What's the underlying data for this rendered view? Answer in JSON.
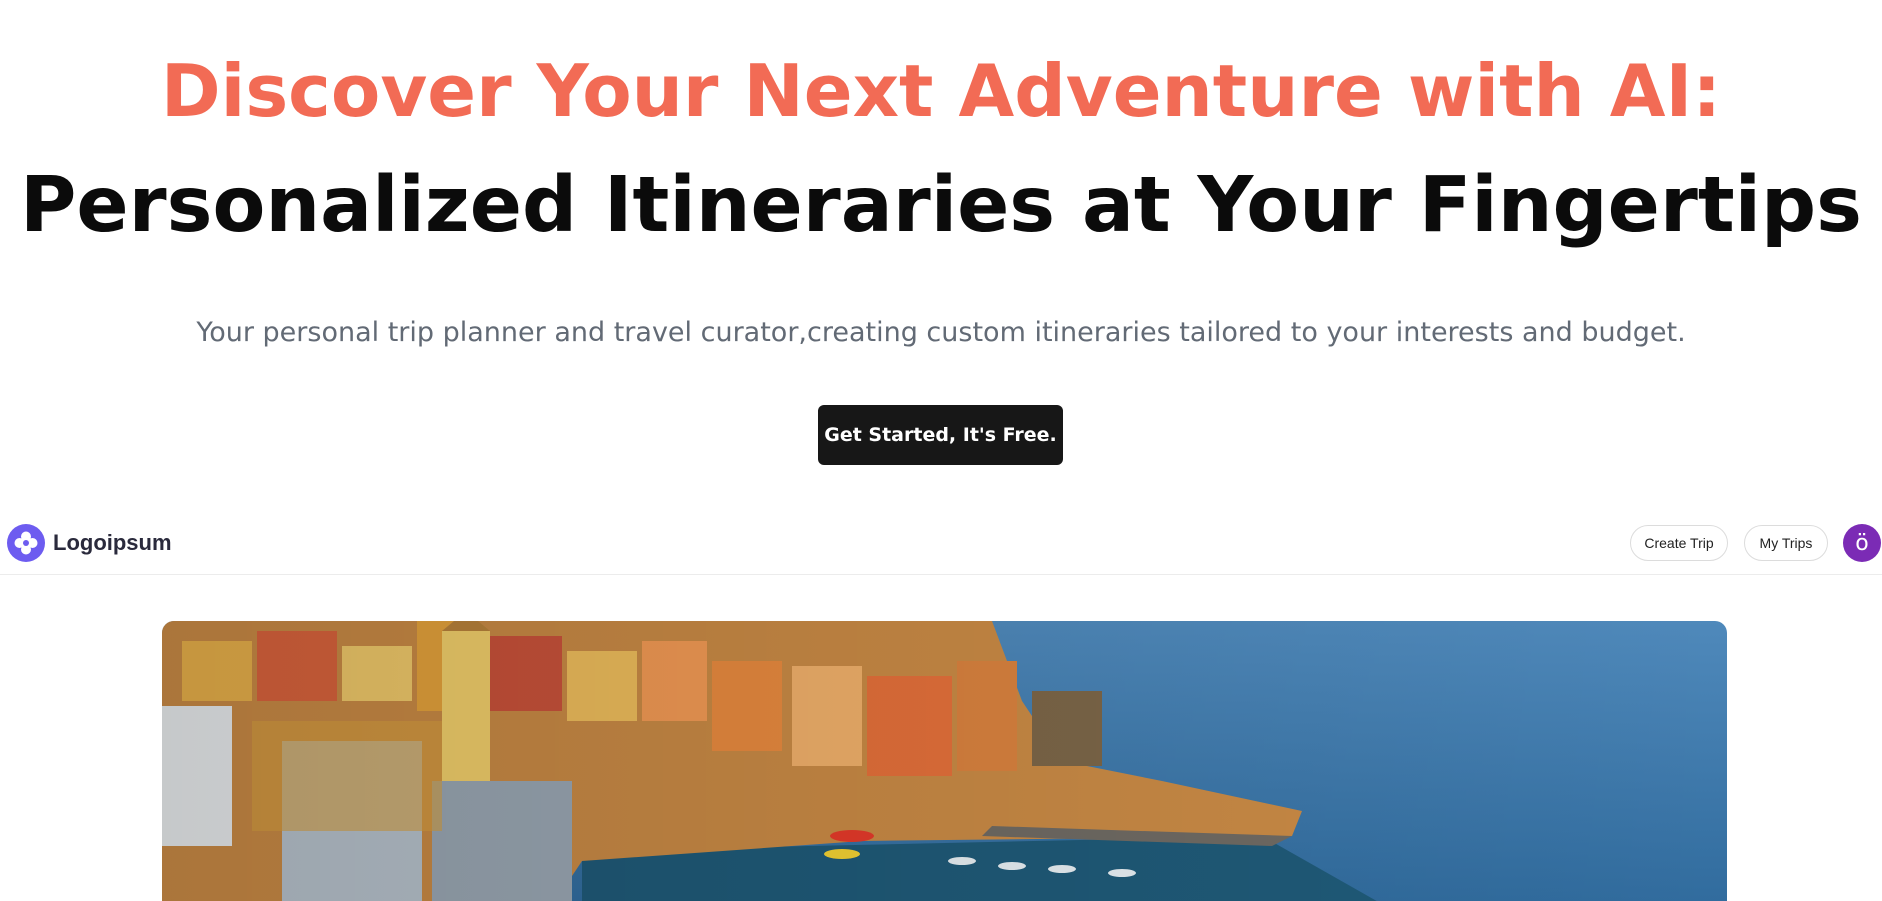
{
  "hero": {
    "headline_accent": "Discover Your Next Adventure with AI:",
    "headline_main": "Personalized Itineraries at Your Fingertips",
    "subtitle": "Your personal trip planner and travel curator,creating custom itineraries tailored to your interests and budget.",
    "cta_label": "Get Started, It's Free."
  },
  "preview": {
    "logo_text": "Logoipsum",
    "nav": {
      "create_trip": "Create Trip",
      "my_trips": "My Trips",
      "avatar_initial": "ö"
    }
  },
  "colors": {
    "accent": "#f26b55",
    "cta_background": "#171717",
    "logo": "#6d5cf0",
    "avatar": "#7b2bb5"
  },
  "icons": {
    "logo": "logoipsum-flower-icon"
  }
}
